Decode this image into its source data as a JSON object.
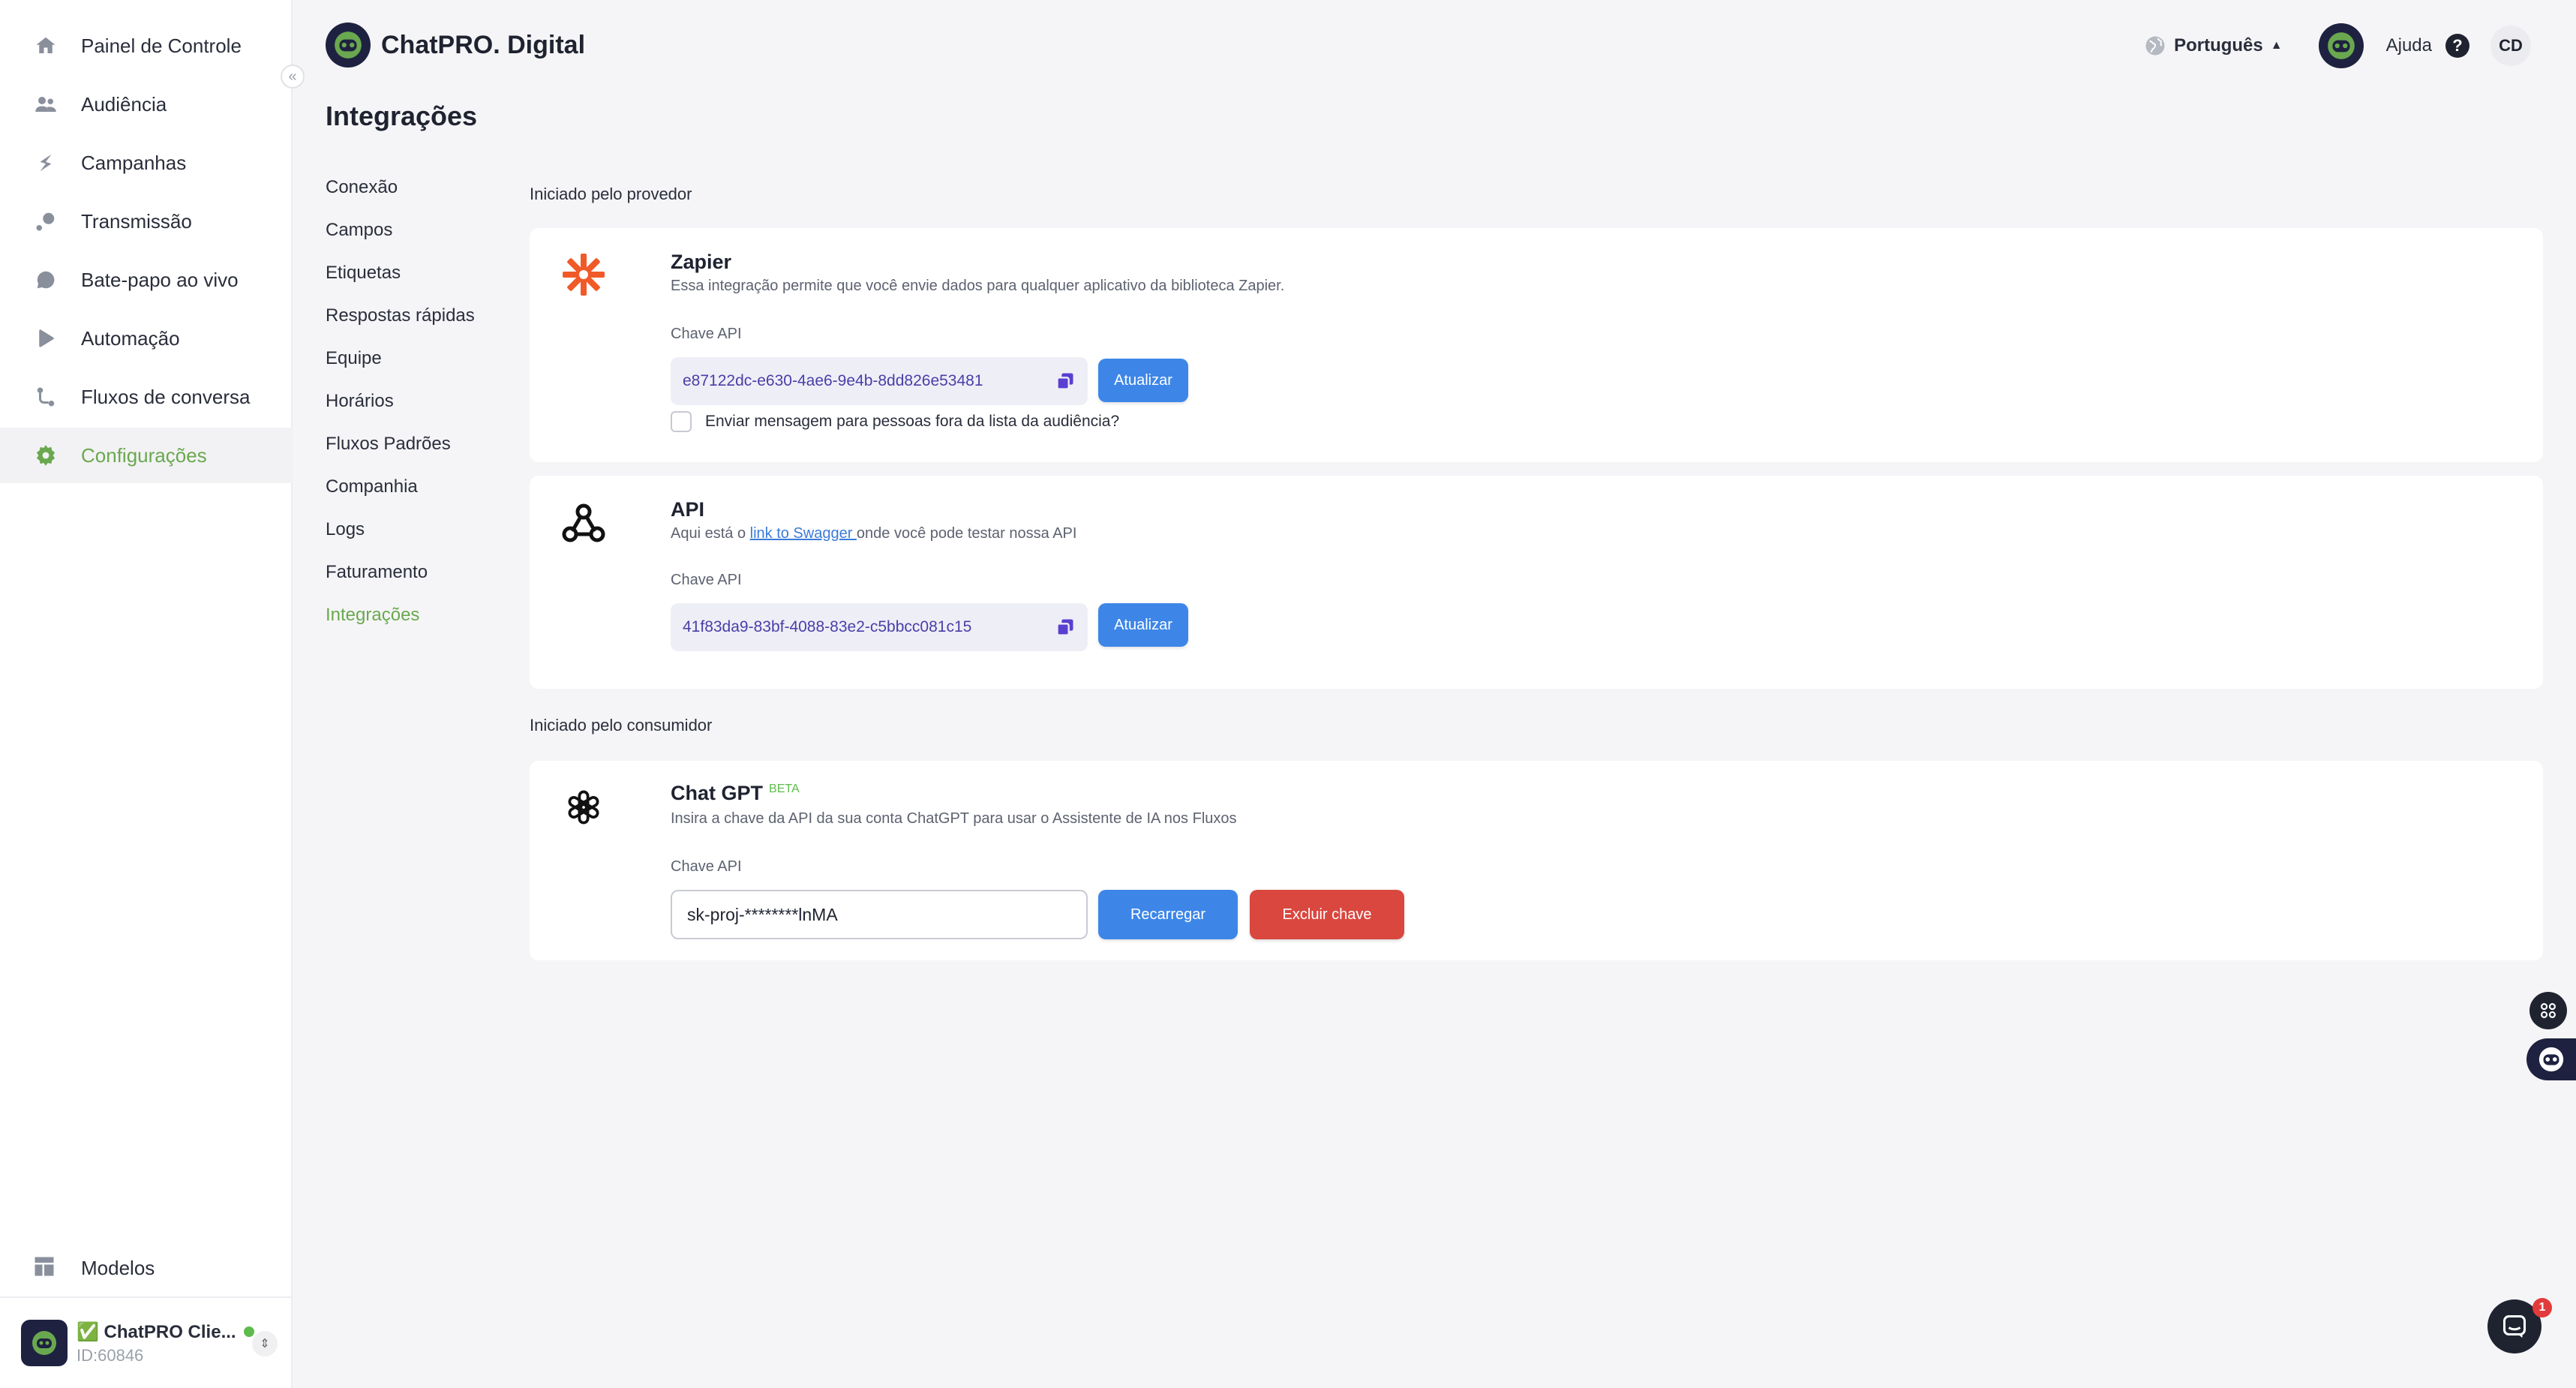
{
  "sidebar": {
    "items": [
      {
        "label": "Painel de Controle",
        "icon": "home-icon"
      },
      {
        "label": "Audiência",
        "icon": "people-icon"
      },
      {
        "label": "Campanhas",
        "icon": "campaign-icon"
      },
      {
        "label": "Transmissão",
        "icon": "broadcast-icon"
      },
      {
        "label": "Bate-papo ao vivo",
        "icon": "chat-bubble-icon"
      },
      {
        "label": "Automação",
        "icon": "play-icon"
      },
      {
        "label": "Fluxos de conversa",
        "icon": "flow-icon"
      },
      {
        "label": "Configurações",
        "icon": "gear-icon",
        "active": true
      }
    ],
    "templates_label": "Modelos",
    "account": {
      "name": "✅ ChatPRO Clie...",
      "id": "ID:60846"
    },
    "accent_color": "#6aa84f"
  },
  "header": {
    "brand": "ChatPRO. Digital",
    "language": "Português",
    "help": "Ajuda",
    "initials": "CD"
  },
  "page": {
    "title": "Integrações"
  },
  "subnav": [
    "Conexão",
    "Campos",
    "Etiquetas",
    "Respostas rápidas",
    "Equipe",
    "Horários",
    "Fluxos Padrões",
    "Companhia",
    "Logs",
    "Faturamento",
    "Integrações"
  ],
  "sections": {
    "provider": "Iniciado pelo provedor",
    "consumer": "Iniciado pelo consumidor"
  },
  "zapier": {
    "title": "Zapier",
    "description": "Essa integração permite que você envie dados para qualquer aplicativo da biblioteca Zapier.",
    "field_label": "Chave API",
    "key": "e87122dc-e630-4ae6-9e4b-8dd826e53481",
    "button": "Atualizar",
    "checkbox_label": "Enviar mensagem para pessoas fora da lista da audiência?",
    "checked": false
  },
  "api": {
    "title": "API",
    "desc_before": "Aqui está o ",
    "desc_link": "link to Swagger ",
    "desc_after": "onde você pode testar nossa API",
    "field_label": "Chave API",
    "key": "41f83da9-83bf-4088-83e2-c5bbcc081c15",
    "button": "Atualizar"
  },
  "chatgpt": {
    "title": "Chat GPT",
    "badge": "BETA",
    "description": "Insira a chave da API da sua conta ChatGPT para usar o Assistente de IA nos Fluxos",
    "field_label": "Chave API",
    "key": "sk-proj-********lnMA",
    "reload_button": "Recarregar",
    "delete_button": "Excluir chave"
  },
  "chat_launcher": {
    "badge": "1"
  }
}
